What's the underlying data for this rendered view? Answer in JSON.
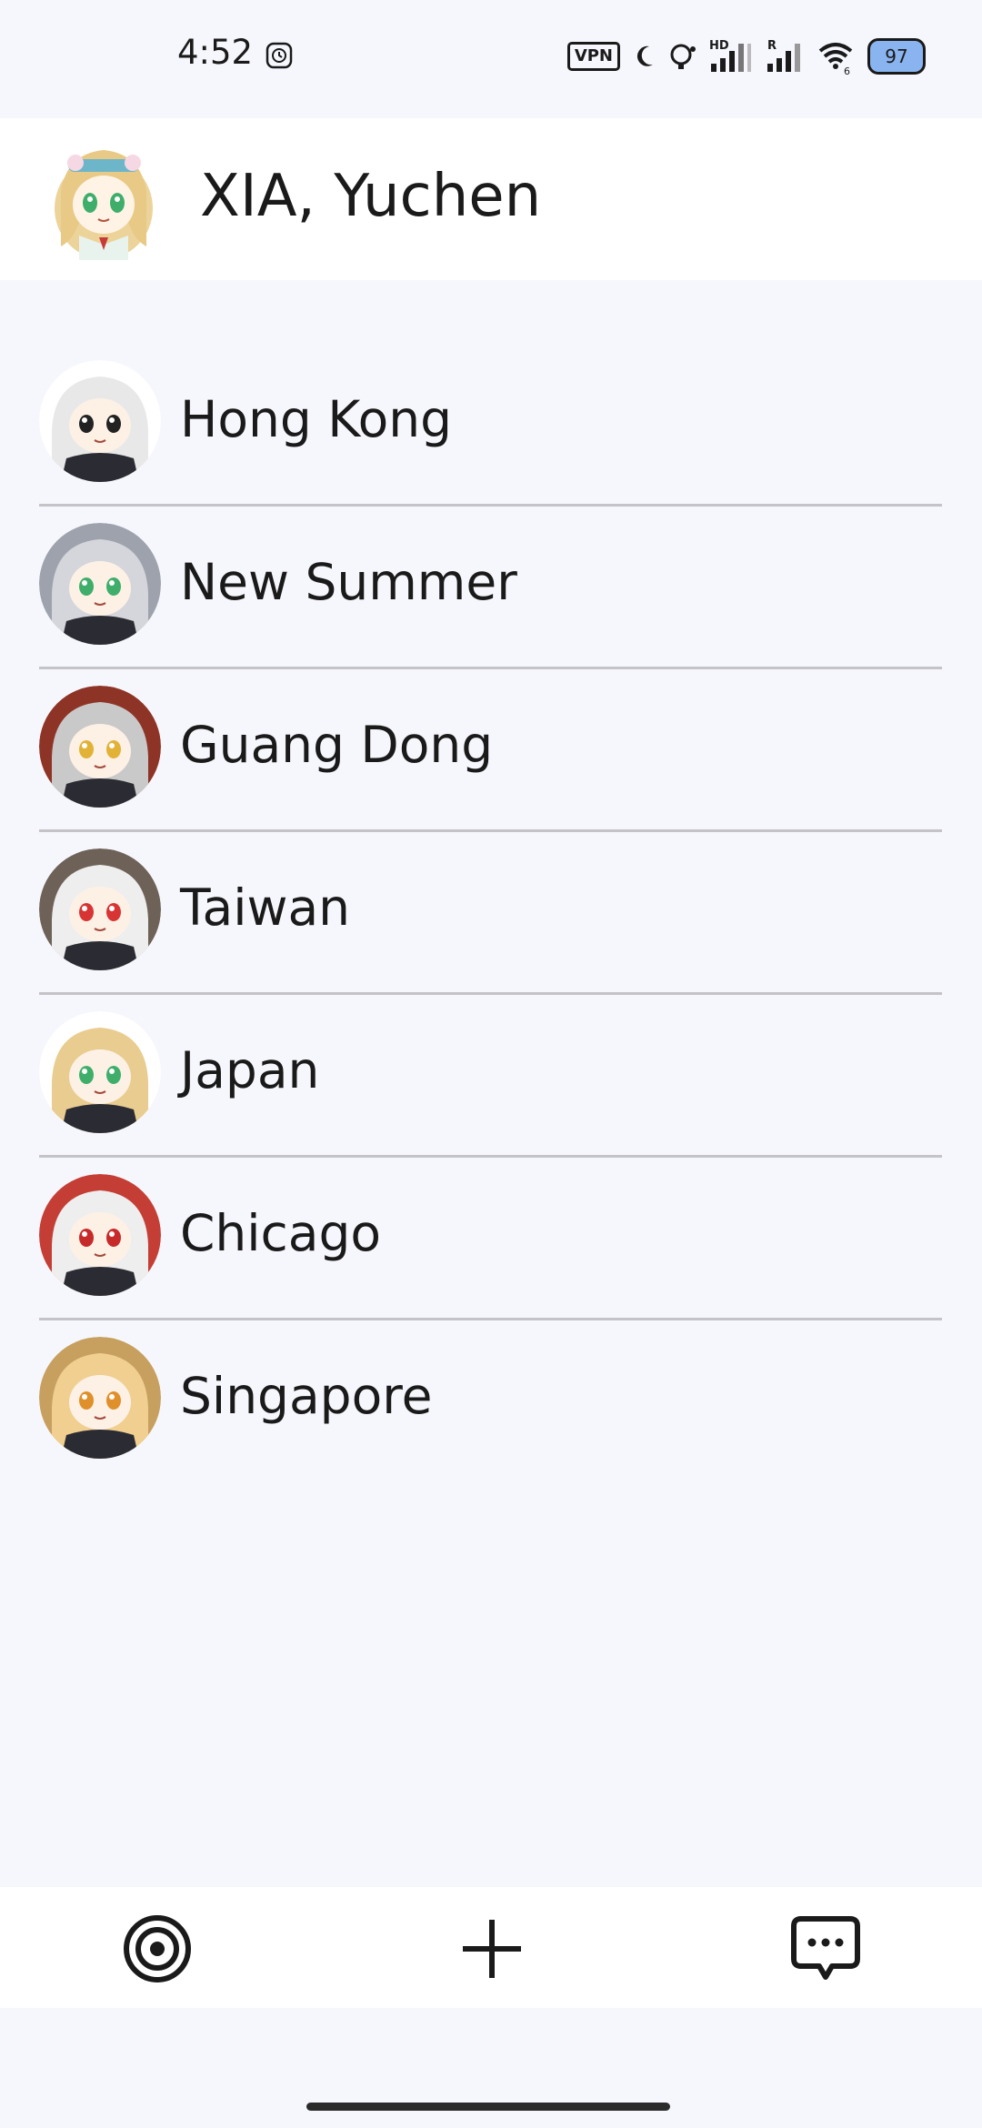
{
  "status_bar": {
    "time": "4:52",
    "vpn_label": "VPN",
    "battery_level": "97",
    "icons": [
      "clock-icon",
      "moon-icon",
      "hotspot-icon",
      "signal-hd-icon",
      "signal-r-icon",
      "wifi-icon",
      "battery-icon"
    ]
  },
  "header": {
    "title": "XIA, Yuchen",
    "avatar_icon": "profile-avatar"
  },
  "chats": [
    {
      "label": "Hong Kong",
      "avatar_bg": "#ffffff",
      "hair": "#e8e8e8",
      "eyes": "#222222"
    },
    {
      "label": "New Summer",
      "avatar_bg": "#9ea2ad",
      "hair": "#d4d6db",
      "eyes": "#3fae6a"
    },
    {
      "label": "Guang Dong",
      "avatar_bg": "#8e3426",
      "hair": "#c9c9c9",
      "eyes": "#e2b236"
    },
    {
      "label": "Taiwan",
      "avatar_bg": "#6e6258",
      "hair": "#eeeeee",
      "eyes": "#d83434"
    },
    {
      "label": "Japan",
      "avatar_bg": "#ffffff",
      "hair": "#e9cc8f",
      "eyes": "#3fae6a"
    },
    {
      "label": "Chicago",
      "avatar_bg": "#c43e35",
      "hair": "#eeeeee",
      "eyes": "#c72a2a"
    },
    {
      "label": "Singapore",
      "avatar_bg": "#c7a060",
      "hair": "#f0cf90",
      "eyes": "#e0902a"
    }
  ],
  "bottom_nav": {
    "items": [
      "target-icon",
      "plus-icon",
      "chat-bubble-icon"
    ]
  },
  "colors": {
    "background": "#f6f7fc",
    "surface": "#ffffff",
    "text": "#1a1a1a",
    "divider": "#c4c4c8",
    "battery_fill": "#8ab4f0"
  }
}
